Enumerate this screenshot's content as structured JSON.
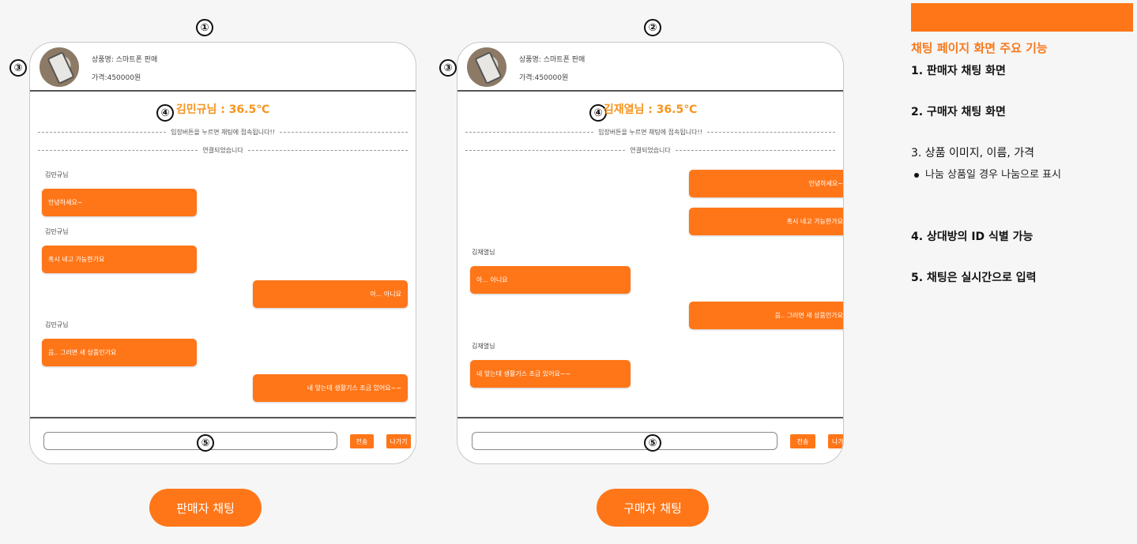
{
  "markers": [
    "①",
    "②",
    "③",
    "③",
    "④",
    "④",
    "⑤",
    "⑤"
  ],
  "seller": {
    "product_name": "상품명: 스마트폰 판매",
    "product_price": "가격:450000원",
    "title": "김민규님 : 36.5℃",
    "notices": [
      "입장버튼을 누르면 채팅에 접속됩니다!!",
      "연결되었습니다"
    ],
    "messages": [
      {
        "side": "left",
        "name": "김민규님",
        "text": "안녕하세요~"
      },
      {
        "side": "left",
        "name": "김민규님",
        "text": "혹시 네고 가능한가요"
      },
      {
        "side": "right",
        "name": "",
        "text": "아... 아니요"
      },
      {
        "side": "left",
        "name": "김민규님",
        "text": "음.. 그러면 새 상품인가요"
      },
      {
        "side": "right",
        "name": "",
        "text": "네 앞는데 생활기스 조금 있어요~~"
      }
    ],
    "send_label": "전송",
    "exit_label": "나가기",
    "caption": "판매자 채팅"
  },
  "buyer": {
    "product_name": "상품명: 스마트폰 판매",
    "product_price": "가격:450000원",
    "title": "김재열님 : 36.5℃",
    "notices": [
      "입장버튼을 누르면 채팅에 접속됩니다!!",
      "연결되었습니다"
    ],
    "messages": [
      {
        "side": "right",
        "name": "",
        "text": "안녕하세요~"
      },
      {
        "side": "right",
        "name": "",
        "text": "혹시 네고 가능한가요"
      },
      {
        "side": "left",
        "name": "김재열님",
        "text": "아... 아니요"
      },
      {
        "side": "right",
        "name": "",
        "text": "음.. 그러면 새 상품인가요"
      },
      {
        "side": "left",
        "name": "김재열님",
        "text": "네 앞는데 생활기스 조금 있어요~~"
      }
    ],
    "send_label": "전송",
    "exit_label": "나가기",
    "caption": "구매자 채팅"
  },
  "sidebar": {
    "title": "채팅 페이지 화면 주요 기능",
    "items": [
      "1. 판매자 채팅 화면",
      "2. 구매자 채팅 화면",
      "3. 상품 이미지, 이름, 가격",
      "5. 채팅은 실시간으로 입력"
    ],
    "bullet": "나눔 상품일 경우 나눔으로 표시",
    "item4": "4. 상대방의 ID 식별 가능"
  },
  "colors": {
    "accent": "#ff7618",
    "title": "#f7941d"
  }
}
